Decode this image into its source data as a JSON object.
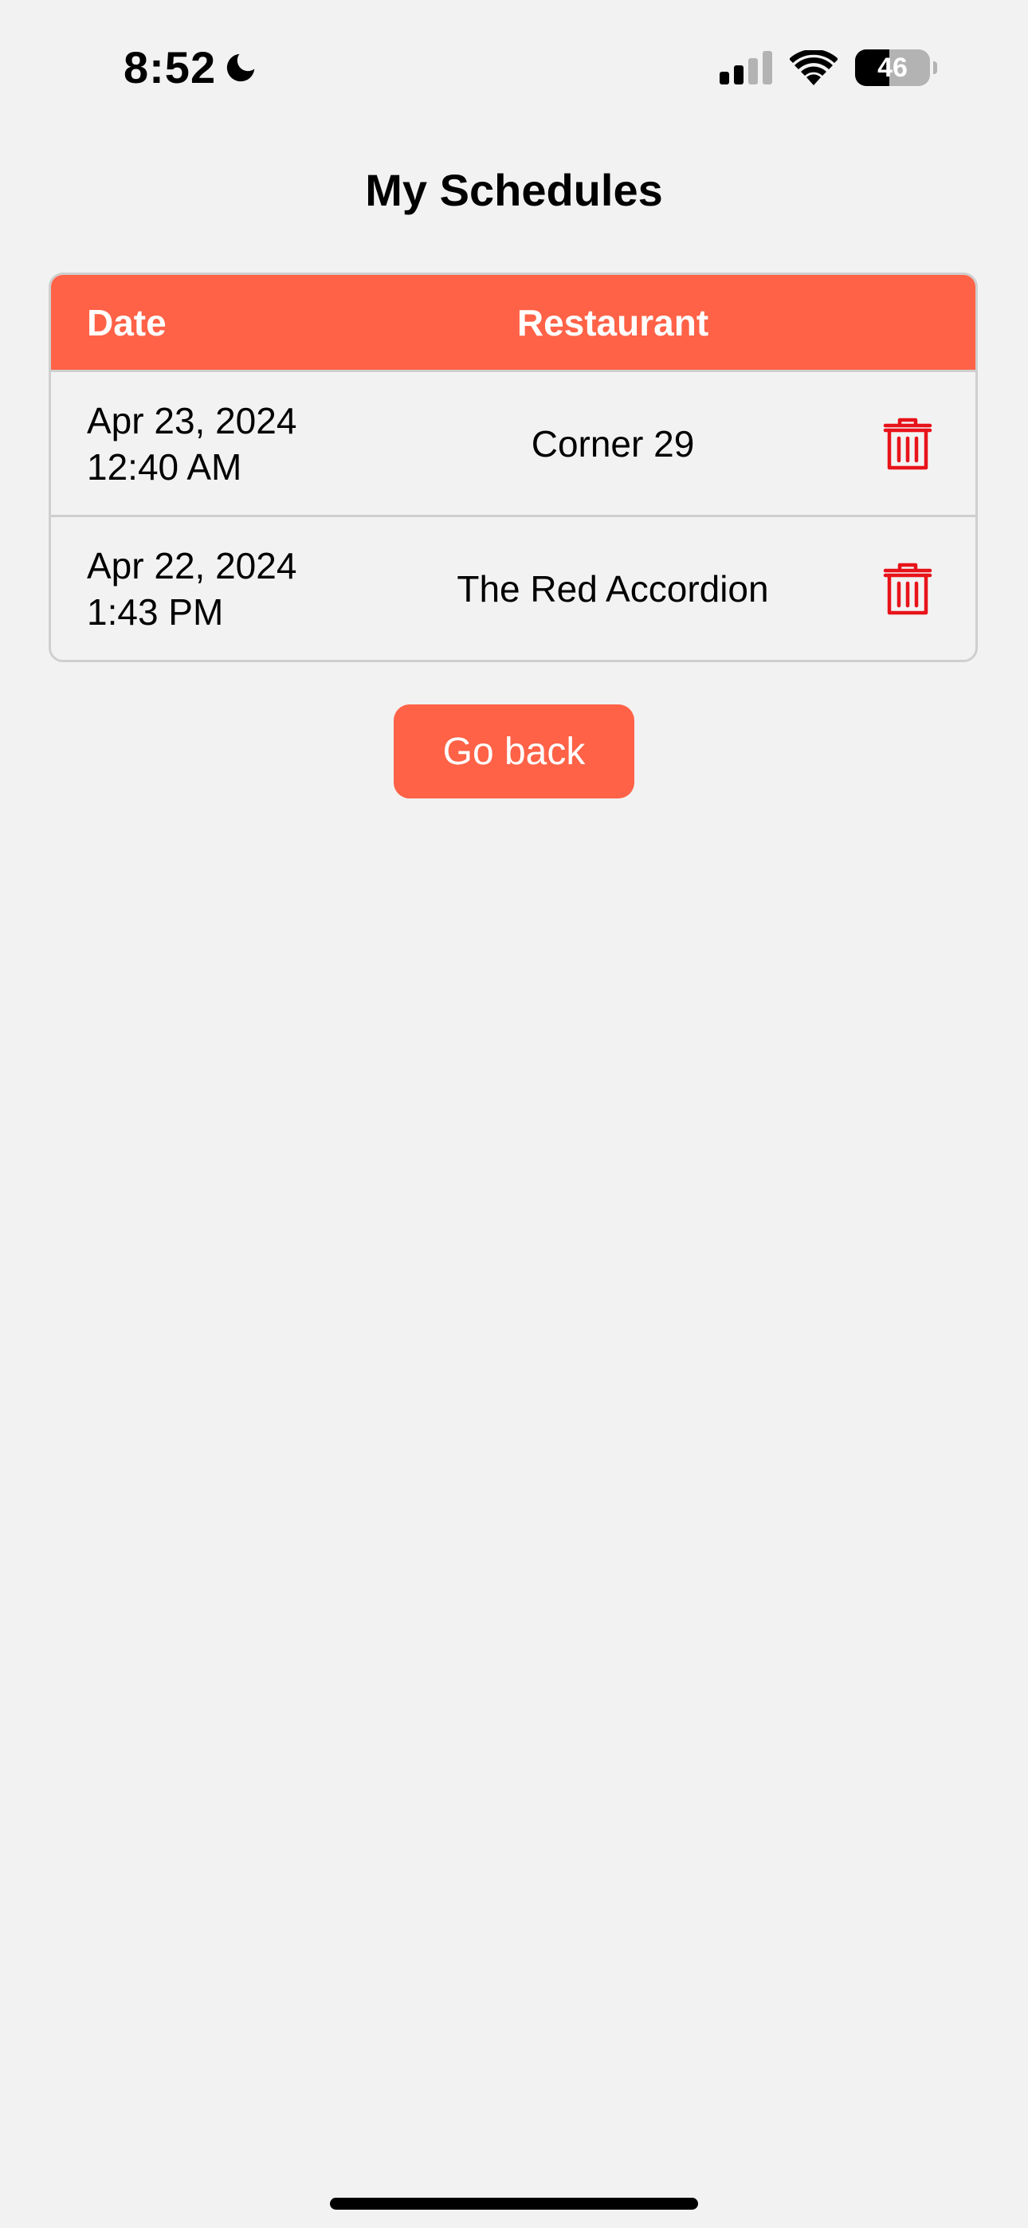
{
  "status_bar": {
    "time": "8:52",
    "battery_level": "46",
    "battery_fraction": 0.46,
    "icons": [
      "moon-icon",
      "signal-icon",
      "wifi-icon",
      "battery-icon"
    ]
  },
  "page": {
    "title": "My Schedules"
  },
  "table": {
    "headers": {
      "date": "Date",
      "restaurant": "Restaurant"
    },
    "rows": [
      {
        "date_line1": "Apr 23, 2024",
        "date_line2": "12:40 AM",
        "restaurant": "Corner 29",
        "action_icon": "trash-icon"
      },
      {
        "date_line1": "Apr 22, 2024",
        "date_line2": "1:43 PM",
        "restaurant": "The Red Accordion",
        "action_icon": "trash-icon"
      }
    ]
  },
  "actions": {
    "go_back_label": "Go back"
  },
  "colors": {
    "accent": "#ff6247",
    "background": "#f2f2f2",
    "delete_icon": "#e8131a",
    "border": "#cfcfcf"
  }
}
